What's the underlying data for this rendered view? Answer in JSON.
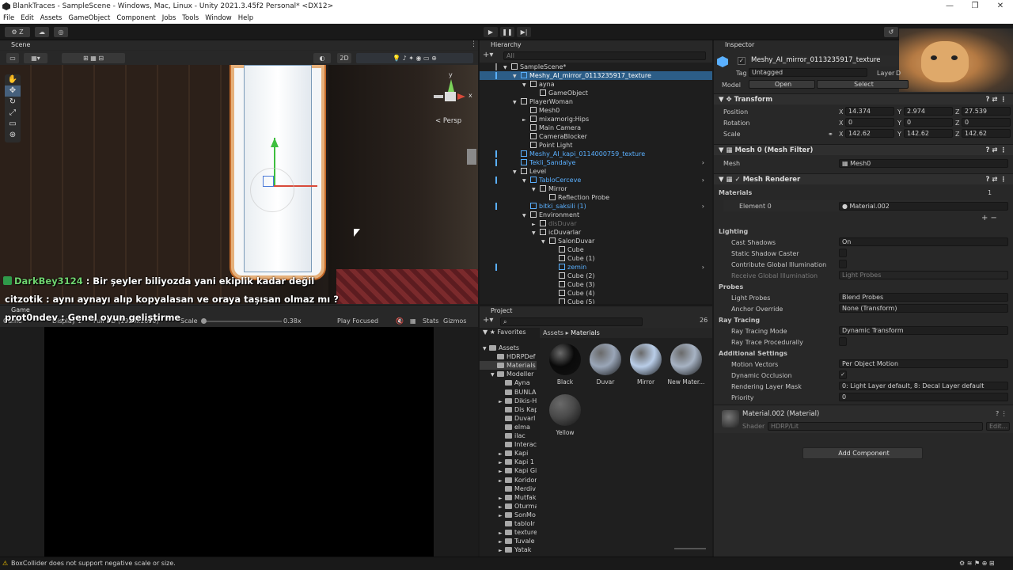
{
  "window": {
    "title": "BlankTraces - SampleScene - Windows, Mac, Linux - Unity 2021.3.45f2 Personal* <DX12>",
    "controls": [
      "—",
      "❐",
      "✕"
    ]
  },
  "menu": [
    "File",
    "Edit",
    "Assets",
    "GameObject",
    "Component",
    "Jobs",
    "Tools",
    "Window",
    "Help"
  ],
  "toolbar": {
    "account": "Z",
    "play_icon": "play-icon",
    "pause_icon": "pause-icon",
    "step_icon": "step-icon"
  },
  "scene_panel": {
    "tab": "Scene",
    "view_2d": "2D",
    "persp_label": "< Persp",
    "gizmo_axis": {
      "y": "y",
      "x": "x"
    }
  },
  "chat": [
    {
      "user": "DarkBey3124",
      "text": " : Bir şeyler biliyozda yani ekiplik kadar değil",
      "color": "#6fd36f"
    },
    {
      "user": "citzotik",
      "text": " : aynı aynayı alıp kopyalasan ve oraya taşısan olmaz mı ?",
      "color": "#e8e8e8"
    },
    {
      "user": "prot0ndev",
      "text": " : Genel oyun geliştirme",
      "color": "#e8e8e8"
    }
  ],
  "game_panel": {
    "tab": "Game",
    "mode": "Game",
    "display": "Display 1",
    "resolution": "Full HD (1920x1080)",
    "scale_label": "Scale",
    "scale_value": "0.38x",
    "play_focused": "Play Focused",
    "stats": "Stats",
    "gizmos": "Gizmos"
  },
  "hierarchy": {
    "tab": "Hierarchy",
    "search_placeholder": "All",
    "rows": [
      {
        "label": "SampleScene*",
        "indent": 0,
        "kind": "scene",
        "arrow": "▼"
      },
      {
        "label": "Meshy_AI_mirror_0113235917_texture",
        "indent": 1,
        "kind": "prefab",
        "arrow": "▼",
        "selected": true
      },
      {
        "label": "ayna",
        "indent": 2,
        "kind": "obj",
        "arrow": "▼"
      },
      {
        "label": "GameObject",
        "indent": 3,
        "kind": "obj",
        "arrow": ""
      },
      {
        "label": "PlayerWoman",
        "indent": 1,
        "kind": "obj",
        "arrow": "▼"
      },
      {
        "label": "Mesh0",
        "indent": 2,
        "kind": "obj",
        "arrow": ""
      },
      {
        "label": "mixamorig:Hips",
        "indent": 2,
        "kind": "obj",
        "arrow": "►"
      },
      {
        "label": "Main Camera",
        "indent": 2,
        "kind": "obj",
        "arrow": ""
      },
      {
        "label": "CameraBlocker",
        "indent": 2,
        "kind": "obj",
        "arrow": ""
      },
      {
        "label": "Point Light",
        "indent": 2,
        "kind": "obj",
        "arrow": ""
      },
      {
        "label": "Meshy_AI_kapi_0114000759_texture",
        "indent": 1,
        "kind": "prefab",
        "arrow": ""
      },
      {
        "label": "Tekli_Sandalye",
        "indent": 1,
        "kind": "prefab",
        "arrow": "",
        "chevron": true
      },
      {
        "label": "Level",
        "indent": 1,
        "kind": "obj",
        "arrow": "▼"
      },
      {
        "label": "TabloCerceve",
        "indent": 2,
        "kind": "prefab",
        "arrow": "▼",
        "chevron": true
      },
      {
        "label": "Mirror",
        "indent": 3,
        "kind": "obj",
        "arrow": "▼"
      },
      {
        "label": "Reflection Probe",
        "indent": 4,
        "kind": "obj",
        "arrow": ""
      },
      {
        "label": "bitki_saksili (1)",
        "indent": 2,
        "kind": "prefab",
        "arrow": "",
        "chevron": true
      },
      {
        "label": "Environment",
        "indent": 2,
        "kind": "obj",
        "arrow": "▼"
      },
      {
        "label": "disDuvar",
        "indent": 3,
        "kind": "dim",
        "arrow": "►"
      },
      {
        "label": "icDuvarlar",
        "indent": 3,
        "kind": "obj",
        "arrow": "▼"
      },
      {
        "label": "SalonDuvar",
        "indent": 4,
        "kind": "obj",
        "arrow": "▼"
      },
      {
        "label": "Cube",
        "indent": 5,
        "kind": "obj",
        "arrow": ""
      },
      {
        "label": "Cube (1)",
        "indent": 5,
        "kind": "obj",
        "arrow": ""
      },
      {
        "label": "zemin",
        "indent": 5,
        "kind": "prefab",
        "arrow": "",
        "chevron": true
      },
      {
        "label": "Cube (2)",
        "indent": 5,
        "kind": "obj",
        "arrow": ""
      },
      {
        "label": "Cube (3)",
        "indent": 5,
        "kind": "obj",
        "arrow": ""
      },
      {
        "label": "Cube (4)",
        "indent": 5,
        "kind": "obj",
        "arrow": ""
      },
      {
        "label": "Cube (5)",
        "indent": 5,
        "kind": "obj",
        "arrow": ""
      }
    ]
  },
  "project": {
    "tab": "Project",
    "favorites": "Favorites",
    "breadcrumb": [
      "Assets",
      "Materials"
    ],
    "count": "26",
    "tree": [
      {
        "label": "Assets",
        "indent": 0,
        "arrow": "▼"
      },
      {
        "label": "HDRPDef",
        "indent": 1,
        "arrow": ""
      },
      {
        "label": "Materials",
        "indent": 1,
        "arrow": "",
        "selected": true
      },
      {
        "label": "Modeller",
        "indent": 1,
        "arrow": "▼"
      },
      {
        "label": "Ayna",
        "indent": 2,
        "arrow": ""
      },
      {
        "label": "BUNLA",
        "indent": 2,
        "arrow": ""
      },
      {
        "label": "Dikis-H",
        "indent": 2,
        "arrow": "►"
      },
      {
        "label": "Dis Kap",
        "indent": 2,
        "arrow": ""
      },
      {
        "label": "Duvarl",
        "indent": 2,
        "arrow": ""
      },
      {
        "label": "elma",
        "indent": 2,
        "arrow": ""
      },
      {
        "label": "ilac",
        "indent": 2,
        "arrow": ""
      },
      {
        "label": "Interac",
        "indent": 2,
        "arrow": ""
      },
      {
        "label": "Kapi",
        "indent": 2,
        "arrow": "►"
      },
      {
        "label": "Kapi 1",
        "indent": 2,
        "arrow": "►"
      },
      {
        "label": "Kapi Gi",
        "indent": 2,
        "arrow": "►"
      },
      {
        "label": "Koridor",
        "indent": 2,
        "arrow": "►"
      },
      {
        "label": "Merdiv",
        "indent": 2,
        "arrow": ""
      },
      {
        "label": "Mutfak",
        "indent": 2,
        "arrow": "►"
      },
      {
        "label": "Oturma",
        "indent": 2,
        "arrow": "►"
      },
      {
        "label": "SonMo",
        "indent": 2,
        "arrow": "►"
      },
      {
        "label": "tabloIr",
        "indent": 2,
        "arrow": ""
      },
      {
        "label": "texture",
        "indent": 2,
        "arrow": "►"
      },
      {
        "label": "Tuvale",
        "indent": 2,
        "arrow": "►"
      },
      {
        "label": "Yatak",
        "indent": 2,
        "arrow": "►"
      }
    ],
    "materials": [
      {
        "label": "Black",
        "color": "#0a0a0a"
      },
      {
        "label": "Duvar",
        "color": "#9aa6b8"
      },
      {
        "label": "Mirror",
        "color": "#b9cde8"
      },
      {
        "label": "New Mater...",
        "color": "#a7b3c4"
      },
      {
        "label": "Yellow",
        "color": "#4a4a4a"
      }
    ]
  },
  "inspector": {
    "tab": "Inspector",
    "object_name": "Meshy_AI_mirror_0113235917_texture",
    "tag_label": "Tag",
    "tag_value": "Untagged",
    "layer_label": "Layer",
    "layer_value": "D",
    "model_label": "Model",
    "open_btn": "Open",
    "select_btn": "Select",
    "transform": {
      "title": "Transform",
      "position_label": "Position",
      "rotation_label": "Rotation",
      "scale_label": "Scale",
      "position": {
        "x": "14.374",
        "y": "2.974",
        "z": "27.539"
      },
      "rotation": {
        "x": "0",
        "y": "0",
        "z": "0"
      },
      "scale": {
        "x": "142.62",
        "y": "142.62",
        "z": "142.62"
      }
    },
    "mesh_filter": {
      "title": "Mesh 0 (Mesh Filter)",
      "mesh_label": "Mesh",
      "mesh_value": "Mesh0"
    },
    "mesh_renderer": {
      "title": "Mesh Renderer",
      "materials_label": "Materials",
      "materials_count": "1",
      "element_label": "Element 0",
      "element_value": "Material.002",
      "lighting": "Lighting",
      "cast_shadows_label": "Cast Shadows",
      "cast_shadows_value": "On",
      "static_shadow_label": "Static Shadow Caster",
      "contribute_gi_label": "Contribute Global Illumination",
      "receive_gi_label": "Receive Global Illumination",
      "receive_gi_value": "Light Probes",
      "probes": "Probes",
      "light_probes_label": "Light Probes",
      "light_probes_value": "Blend Probes",
      "anchor_label": "Anchor Override",
      "anchor_value": "None (Transform)",
      "ray_tracing": "Ray Tracing",
      "rt_mode_label": "Ray Tracing Mode",
      "rt_mode_value": "Dynamic Transform",
      "rt_proc_label": "Ray Trace Procedurally",
      "additional": "Additional Settings",
      "motion_label": "Motion Vectors",
      "motion_value": "Per Object Motion",
      "dyn_occ_label": "Dynamic Occlusion",
      "rlm_label": "Rendering Layer Mask",
      "rlm_value": "0: Light Layer default, 8: Decal Layer default",
      "priority_label": "Priority",
      "priority_value": "0"
    },
    "material": {
      "title": "Material.002 (Material)",
      "shader_label": "Shader",
      "shader_value": "HDRP/Lit",
      "edit_btn": "Edit..."
    },
    "add_component": "Add Component"
  },
  "status": {
    "message": "BoxCollider does not support negative scale or size."
  },
  "colors": {
    "accent": "#2c5d87",
    "selection": "#2c5d87",
    "prefab": "#5ab0ff",
    "mirror_frame": "#e0a06a"
  }
}
